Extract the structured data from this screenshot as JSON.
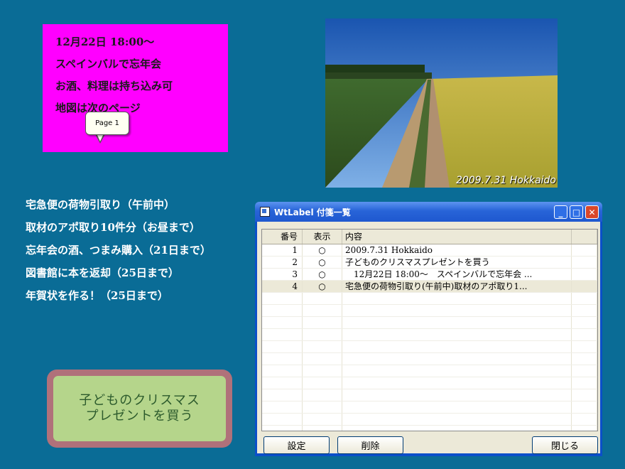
{
  "notes": {
    "magenta_lines": [
      "12月22日 18:00～",
      "スペインバルで忘年会",
      "お酒、料理は持ち込み可",
      "地図は次のページ"
    ],
    "tooltip": "Page 1",
    "green_lines": [
      "子どものクリスマス",
      "プレゼントを買う"
    ],
    "colors": {
      "magenta": "#ff00ff",
      "green": "#b5d58b",
      "green_border": "#b0717a",
      "desktop": "#0a6c96"
    }
  },
  "photo": {
    "caption": "2009.7.31 Hokkaido"
  },
  "todo": [
    "宅急便の荷物引取り（午前中）",
    "取材のアポ取り10件分（お昼まで）",
    "忘年会の酒、つまみ購入（21日まで）",
    "図書館に本を返却（25日まで）",
    "年賀状を作る！（25日まで）"
  ],
  "window": {
    "title": "WtLabel 付箋一覧",
    "controls": {
      "minimize": "_",
      "maximize": "□",
      "close": "✕"
    },
    "columns": [
      "番号",
      "表示",
      "内容"
    ],
    "rows": [
      {
        "num": "1",
        "show": "○",
        "content": "2009.7.31 Hokkaido"
      },
      {
        "num": "2",
        "show": "○",
        "content": "子どものクリスマスプレゼントを買う"
      },
      {
        "num": "3",
        "show": "○",
        "content": "　12月22日 18:00～　スペインバルで忘年会 ..."
      },
      {
        "num": "4",
        "show": "○",
        "content": "宅急便の荷物引取り(午前中)取材のアポ取り1..."
      }
    ],
    "selected_row": 4,
    "buttons": {
      "settings": "設定",
      "delete": "削除",
      "close": "閉じる"
    }
  }
}
